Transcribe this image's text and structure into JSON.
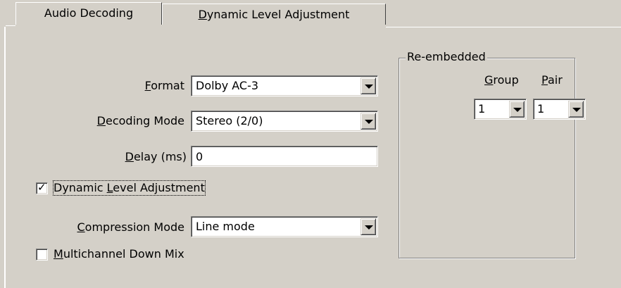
{
  "tabs": [
    {
      "label": "Audio Decoding",
      "active": true
    },
    {
      "label_accel": "D",
      "label_rest": "ynamic Level Adjustment",
      "active": false
    }
  ],
  "format": {
    "label_accel": "F",
    "label_rest": "ormat",
    "value": "Dolby AC-3"
  },
  "decoding_mode": {
    "label_accel": "D",
    "label_rest": "ecoding Mode",
    "value": "Stereo (2/0)"
  },
  "delay": {
    "label_accel": "D",
    "label_rest": "elay (ms)",
    "value": "0"
  },
  "dynamic_level": {
    "label_pre": "Dynamic ",
    "label_accel": "L",
    "label_rest": "evel Adjustment",
    "checked": true
  },
  "compression_mode": {
    "label_accel": "C",
    "label_rest": "ompression Mode",
    "value": "Line mode"
  },
  "multichannel": {
    "label_accel": "M",
    "label_rest": "ultichannel Down Mix",
    "checked": false
  },
  "reembedded": {
    "title": "Re-embedded",
    "group": {
      "label_accel": "G",
      "label_rest": "roup",
      "value": "1"
    },
    "pair": {
      "label_accel": "P",
      "label_rest": "air",
      "value": "1"
    }
  },
  "icons": {
    "dropdown": "chevron-down-icon",
    "check": "checkmark-icon"
  }
}
